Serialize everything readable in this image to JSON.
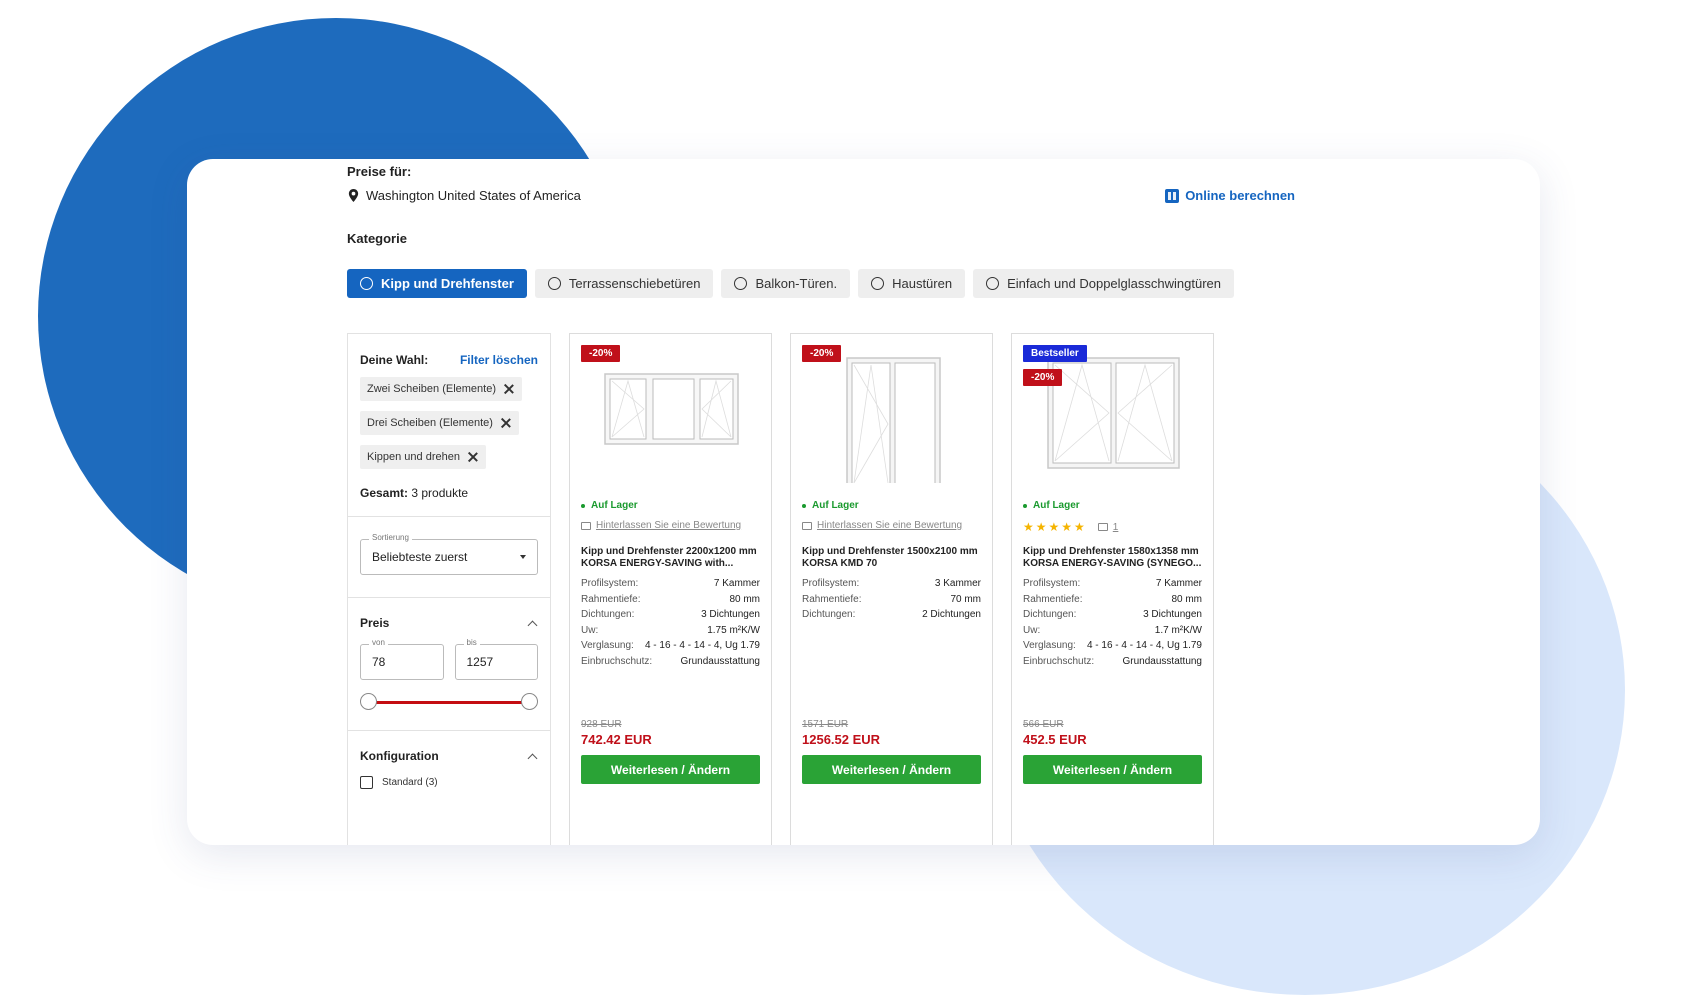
{
  "header": {
    "prices_label": "Preise für:",
    "location": "Washington United States of America",
    "online_calc": "Online berechnen"
  },
  "category": {
    "label": "Kategorie",
    "items": [
      {
        "label": "Kipp und Drehfenster",
        "active": true
      },
      {
        "label": "Terrassenschiebetüren",
        "active": false
      },
      {
        "label": "Balkon-Türen.",
        "active": false
      },
      {
        "label": "Haustüren",
        "active": false
      },
      {
        "label": "Einfach und Doppelglasschwingtüren",
        "active": false
      }
    ]
  },
  "sidebar": {
    "selection_title": "Deine Wahl:",
    "filter_clear": "Filter löschen",
    "chips": [
      "Zwei Scheiben (Elemente)",
      "Drei Scheiben (Elemente)",
      "Kippen und drehen"
    ],
    "total_label": "Gesamt:",
    "total_value": "3 produkte",
    "sort_label": "Sortierung",
    "sort_value": "Beliebteste zuerst",
    "price_title": "Preis",
    "from_label": "von",
    "from_value": "78",
    "to_label": "bis",
    "to_value": "1257",
    "config_title": "Konfiguration",
    "config_option": "Standard (3)"
  },
  "products": [
    {
      "badges": [
        "-20%"
      ],
      "stock": "Auf Lager",
      "review": "Hinterlassen Sie eine Bewertung",
      "title": "Kipp und Drehfenster 2200x1200 mm KORSA ENERGY-SAVING with...",
      "specs": [
        {
          "k": "Profilsystem:",
          "v": "7 Kammer"
        },
        {
          "k": "Rahmentiefe:",
          "v": "80 mm"
        },
        {
          "k": "Dichtungen:",
          "v": "3 Dichtungen"
        },
        {
          "k": "Uw:",
          "v": "1.75 m²K/W"
        },
        {
          "k": "Verglasung:",
          "v": "4 - 16 - 4 - 14 - 4, Ug 1.79"
        },
        {
          "k": "Einbruchschutz:",
          "v": "Grundausstattung"
        }
      ],
      "old_price": "928 EUR",
      "price": "742.42 EUR",
      "button": "Weiterlesen / Ändern"
    },
    {
      "badges": [
        "-20%"
      ],
      "stock": "Auf Lager",
      "review": "Hinterlassen Sie eine Bewertung",
      "title": "Kipp und Drehfenster 1500x2100 mm KORSA KMD 70",
      "specs": [
        {
          "k": "Profilsystem:",
          "v": "3 Kammer"
        },
        {
          "k": "Rahmentiefe:",
          "v": "70 mm"
        },
        {
          "k": "Dichtungen:",
          "v": "2 Dichtungen"
        }
      ],
      "old_price": "1571 EUR",
      "price": "1256.52 EUR",
      "button": "Weiterlesen / Ändern"
    },
    {
      "badges": [
        "Bestseller",
        "-20%"
      ],
      "stock": "Auf Lager",
      "stars": "★★★★★",
      "comments": "1",
      "title": "Kipp und Drehfenster 1580x1358 mm KORSA ENERGY-SAVING (SYNEGO...",
      "specs": [
        {
          "k": "Profilsystem:",
          "v": "7 Kammer"
        },
        {
          "k": "Rahmentiefe:",
          "v": "80 mm"
        },
        {
          "k": "Dichtungen:",
          "v": "3 Dichtungen"
        },
        {
          "k": "Uw:",
          "v": "1.7 m²K/W"
        },
        {
          "k": "Verglasung:",
          "v": "4 - 16 - 4 - 14 - 4, Ug 1.79"
        },
        {
          "k": "Einbruchschutz:",
          "v": "Grundausstattung"
        }
      ],
      "old_price": "566 EUR",
      "price": "452.5 EUR",
      "button": "Weiterlesen / Ändern"
    }
  ],
  "colors": {
    "accent_blue": "#1565c0",
    "sale_red": "#c0101a",
    "bestseller_blue": "#1a2ad8",
    "stock_green": "#1a9a2e",
    "button_green": "#2aa336"
  }
}
